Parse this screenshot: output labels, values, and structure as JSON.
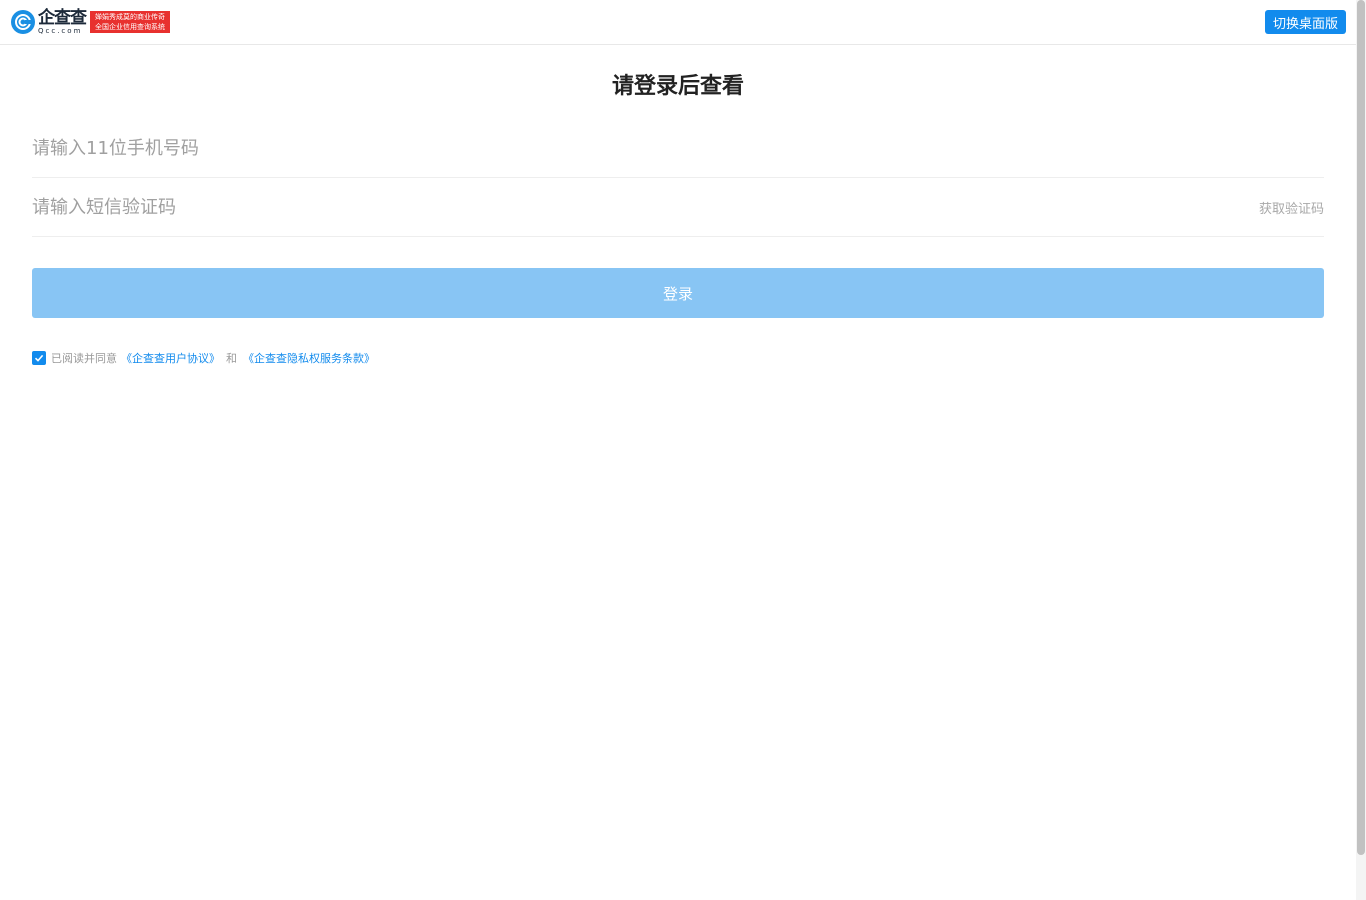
{
  "header": {
    "logo_cn": "企查查",
    "logo_en": "Qcc.com",
    "slogan_line1": "婵娟秀成莫的商业传奇",
    "slogan_line2": "全国企业信用查询系统",
    "switch_button": "切换桌面版"
  },
  "login": {
    "title": "请登录后查看",
    "phone_placeholder": "请输入11位手机号码",
    "code_placeholder": "请输入短信验证码",
    "get_code": "获取验证码",
    "login_button": "登录"
  },
  "agreement": {
    "checked": true,
    "prefix": "已阅读并同意",
    "user_agreement": "《企查查用户协议》",
    "and": "和",
    "privacy_terms": "《企查查隐私权服务条款》"
  },
  "colors": {
    "brand_blue": "#128bed",
    "login_button_disabled": "#88c5f4",
    "slogan_red": "#e8312f"
  }
}
